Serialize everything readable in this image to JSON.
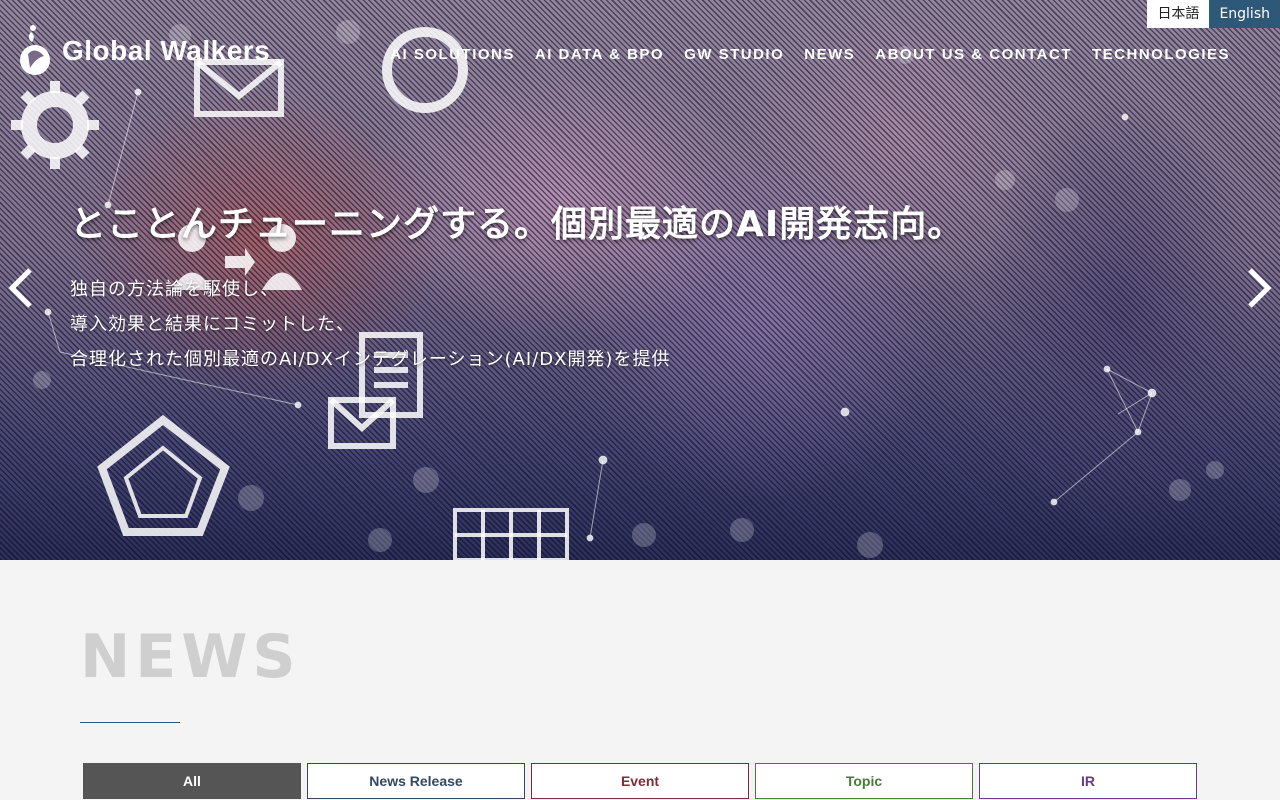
{
  "header": {
    "logo_text": "Global Walkers",
    "languages": [
      "日本語",
      "English"
    ],
    "active_language": "English",
    "nav": [
      "AI SOLUTIONS",
      "AI DATA & BPO",
      "GW STUDIO",
      "NEWS",
      "ABOUT US & CONTACT",
      "TECHNOLOGIES"
    ]
  },
  "hero": {
    "title": "とことんチューニングする。個別最適のAI開発志向。",
    "desc_lines": [
      "独自の方法論を駆使し、",
      "導入効果と結果にコミットした、",
      "合理化された個別最適のAI/DXインテグレーション(AI/DX開発)を提供"
    ],
    "prev_icon": "chevron-left-icon",
    "next_icon": "chevron-right-icon"
  },
  "news": {
    "heading": "NEWS",
    "tabs": [
      "All",
      "News Release",
      "Event",
      "Topic",
      "IR"
    ],
    "active_tab": "All"
  },
  "colors": {
    "accent": "#2d5877",
    "tab_all": "#555555",
    "tab_release": "#33495e",
    "tab_event": "#7a2e36",
    "tab_topic": "#4a7a3a",
    "tab_ir": "#6a3a8a"
  }
}
